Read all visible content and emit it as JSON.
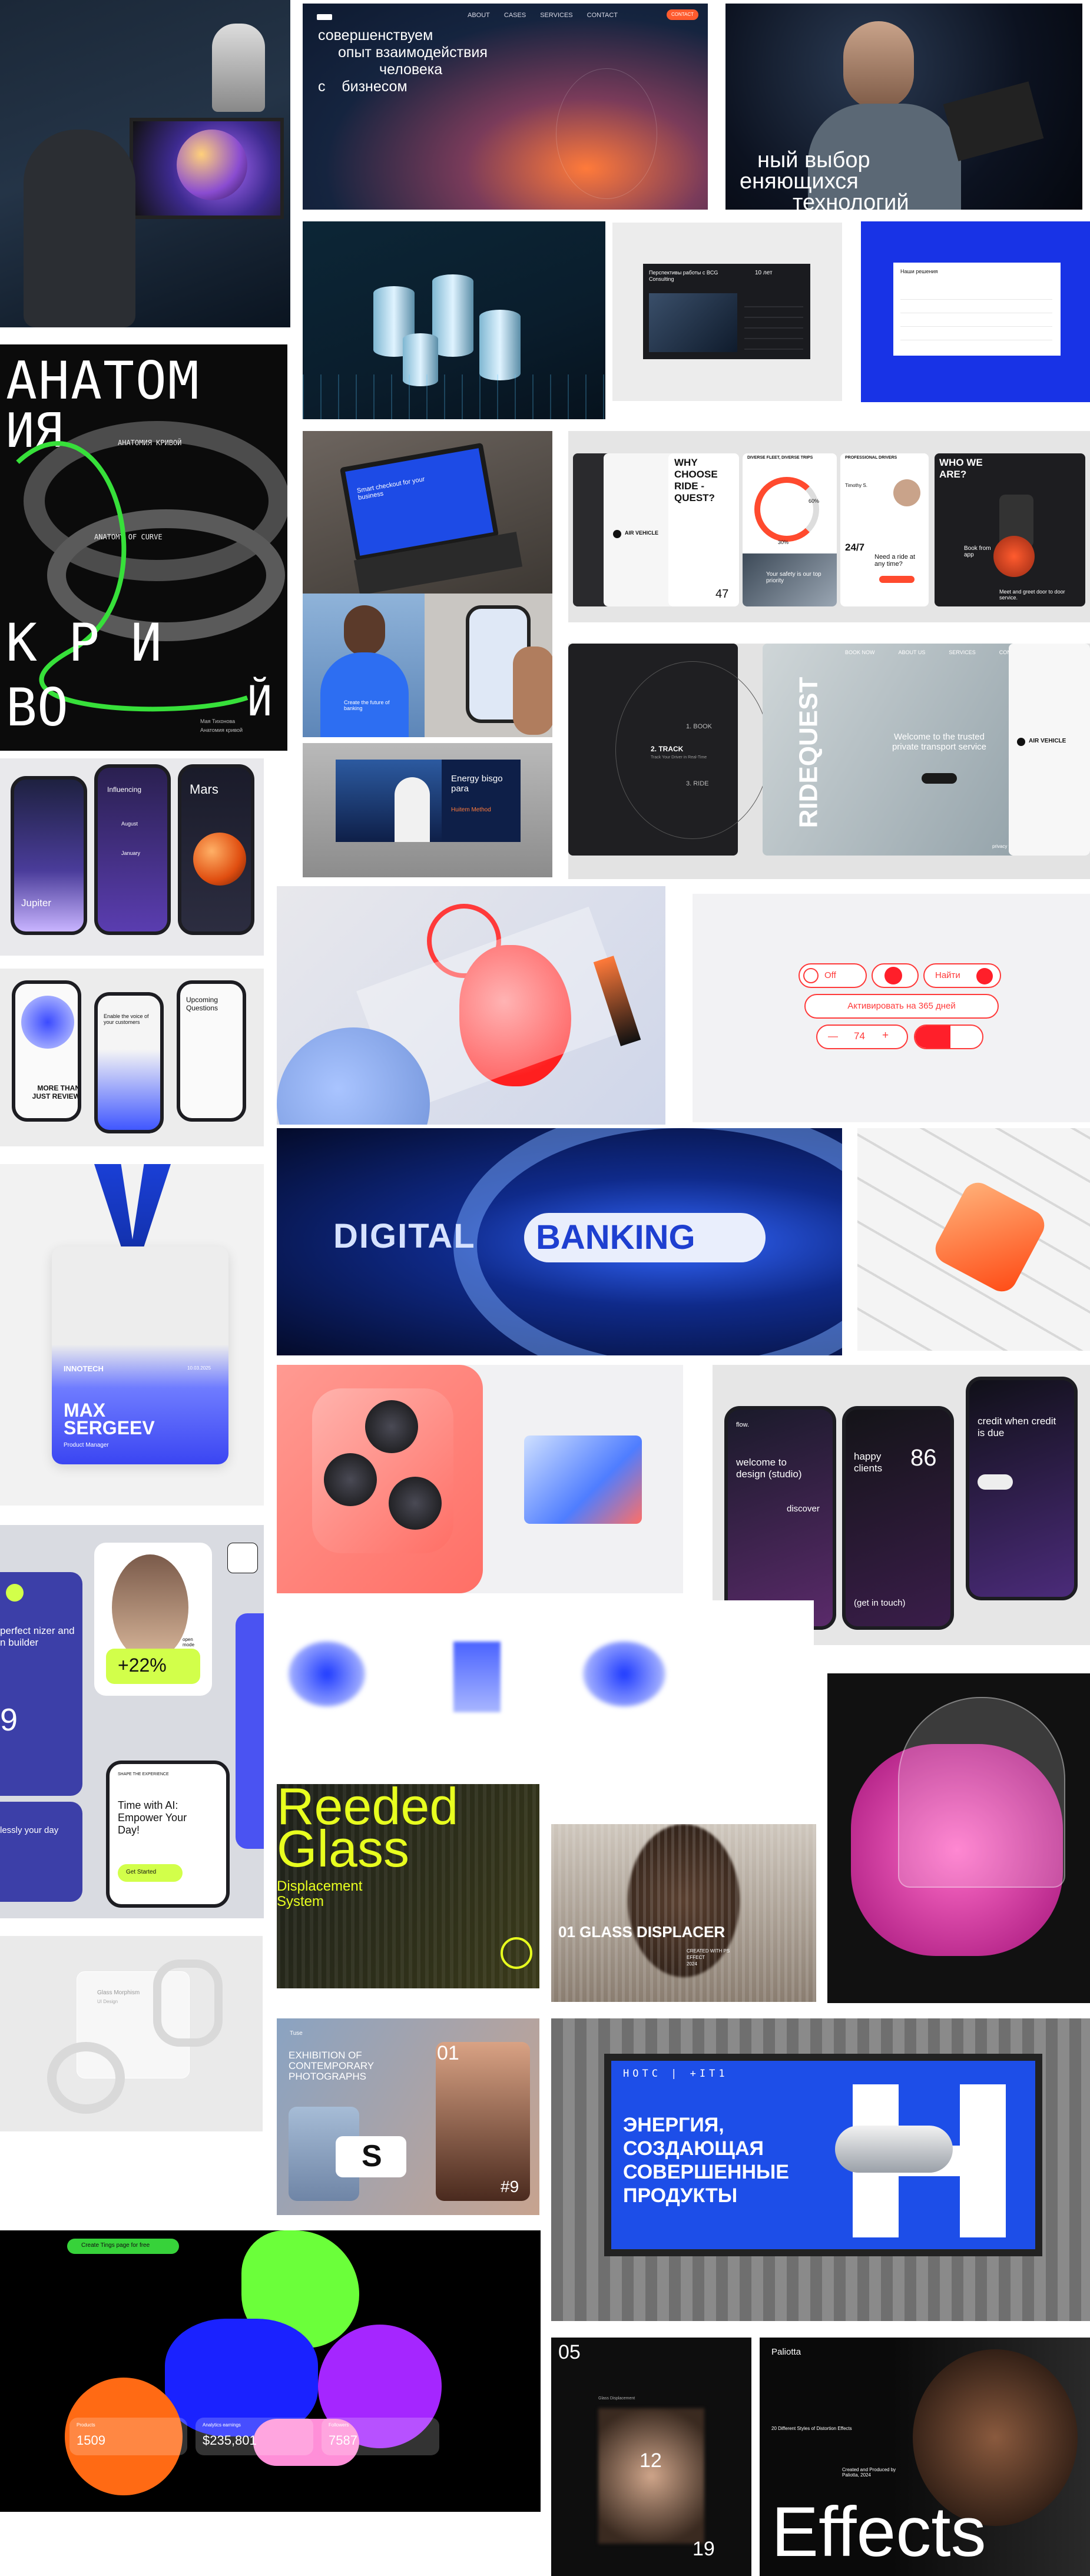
{
  "header": {
    "nav_items": [
      "ABOUT",
      "CASES",
      "SERVICES",
      "CONTACT"
    ],
    "cta": "CONTACT"
  },
  "t_business": {
    "lines": [
      "совершенствуем",
      "опыт взаимодействия",
      "человека",
      "с",
      "бизнесом"
    ]
  },
  "t_man": {
    "lines": [
      "ный выбор",
      "еняющихся",
      "технологий"
    ]
  },
  "t_bcg": {
    "title": "Перспективы работы с BCG Consulting",
    "badge": "10 лет"
  },
  "t_blue_form": {
    "title": "Наши решения"
  },
  "t_anatomy": {
    "title_top": "АНАТОМ",
    "title_2": "ИЯ",
    "title_bottom_1": "К Р И",
    "title_bottom_2": "ВО",
    "title_bottom_3": "Й",
    "ring_texts": [
      "АНАТОМИЯ КРИВОЙ",
      "ANATOMY OF CURVE"
    ],
    "author": "Мая Тихонова",
    "sub": "Анатомия кривой"
  },
  "t_ride": {
    "why": "WHY CHOOSE RIDE - QUEST?",
    "fleet": "DIVERSE FLEET, DIVERSE TRIPS",
    "pro": "PROFESSIONAL DRIVERS",
    "who": "WHO WE ARE?",
    "vehicle": "AIR VEHICLE",
    "stat_1": "60%",
    "stat_2": "30%",
    "safety": "Your safety is our top priority",
    "ride_247": "24/7",
    "need": "Need a ride at any time?",
    "book": "Book from app",
    "meet": "Meet and greet door to door service.",
    "num": "47",
    "driver": "Timothy S."
  },
  "t_ride2": {
    "steps": [
      "1. BOOK",
      "2. TRACK",
      "3. RIDE"
    ],
    "step_sub": "Track Your Driver in Real-Time",
    "brand": "RIDEQUEST",
    "welcome": "Welcome to the trusted private transport service",
    "nav": [
      "BOOK NOW",
      "ABOUT US",
      "SERVICES",
      "CONTACT"
    ],
    "vehicle": "AIR VEHICLE",
    "privacy": "privacy terms"
  },
  "t_laptop": {
    "screen": "Smart checkout for your business"
  },
  "t_woman_blue": {
    "caption": "Create the future of banking"
  },
  "t_energy": {
    "title": "Energy bisgo para",
    "sub": "Huitem Method"
  },
  "t_space": {
    "screens": [
      "Jupiter",
      "Influencing",
      "Mars"
    ],
    "months": [
      "August",
      "January"
    ]
  },
  "t_review": {
    "screens": [
      "MORE THAN JUST REVIEW",
      "Enable the voice of your customers",
      "Upcoming Questions"
    ]
  },
  "t_controls": {
    "off": "Off",
    "find": "Найти",
    "activate": "Активировать на 365 дней",
    "minus": "—",
    "value": "74",
    "plus": "+"
  },
  "t_banking": {
    "left": "DIGITAL",
    "right": "BANKING"
  },
  "t_badge": {
    "brand": "INNOTECH",
    "date": "10.03.2025",
    "name_1": "MAX",
    "name_2": "SERGEEV",
    "role": "Product Manager"
  },
  "t_flow": {
    "brand": "flow.",
    "welcome": "welcome to design (studio)",
    "discover": "discover",
    "happy": "happy clients",
    "count": "86",
    "get": "(get in touch)",
    "credit": "credit when credit is due"
  },
  "t_app": {
    "organizer": "perfect nizer and n builder",
    "percent": "+22%",
    "open": "open mode",
    "big": "9",
    "seamless": "lessly your day",
    "ai_title": "Time with AI: Empower Your Day!",
    "ai_btn": "Get Started",
    "ai_label": "SHAPE THE EXPERIENCE"
  },
  "t_reeded": {
    "title_1": "Reeded",
    "title_2": "Glass",
    "sub_1": "Displacement",
    "sub_2": "System"
  },
  "t_glass_displacer": {
    "title": "01 GLASS DISPLACER",
    "meta": [
      "CREATED WITH PS",
      "EFFECT",
      "2024"
    ]
  },
  "t_glass_card": {
    "title": "Glass Morphism",
    "sub": "UI Design"
  },
  "t_exhibition": {
    "brand": "Tuse",
    "title": "EXHIBITION OF CONTEMPORARY PHOTOGRAPHS",
    "num": "01",
    "tag": "#9",
    "letter": "S"
  },
  "t_billboard": {
    "logo": "НОТС | +IT1",
    "line_1": "ЭНЕРГИЯ,",
    "line_2": "СОЗДАЮЩАЯ",
    "line_3": "СОВЕРШЕННЫЕ",
    "line_4": "ПРОДУКТЫ"
  },
  "t_blobs": {
    "header": "Create Tings page for free",
    "s1_label": "Products",
    "s1": "1509",
    "s2_label": "Analytics earnings",
    "s2": "$235,801",
    "s3_label": "Followers",
    "s3": "7587"
  },
  "t_poster": {
    "n1": "05",
    "n2": "12",
    "n3": "19",
    "caption": "Glass Displacement"
  },
  "t_effects": {
    "brand": "Paliotta",
    "sub": "20 Different Styles of Distortion Effects",
    "credit": "Created and Produced by Paliotta, 2024",
    "title": "Effects"
  },
  "colors": {
    "accent": "#ff4a2e",
    "blue": "#1447ff",
    "green": "#35d23a"
  }
}
